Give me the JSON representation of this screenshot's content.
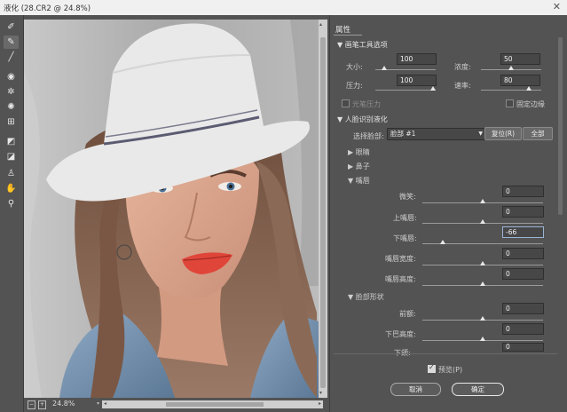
{
  "window": {
    "title": "液化 (28.CR2 @ 24.8%)",
    "close_glyph": "✕"
  },
  "tools": [
    {
      "icon": "forward-warp-icon",
      "glyph": "✐"
    },
    {
      "icon": "reconstruct-icon",
      "glyph": "✎"
    },
    {
      "icon": "smooth-icon",
      "glyph": "╱"
    },
    {
      "icon": "twirl-icon",
      "glyph": "◉"
    },
    {
      "icon": "pucker-icon",
      "glyph": "✲"
    },
    {
      "icon": "bloat-icon",
      "glyph": "✺"
    },
    {
      "icon": "push-left-icon",
      "glyph": "⊞"
    },
    {
      "icon": "freeze-mask-icon",
      "glyph": "◩"
    },
    {
      "icon": "thaw-mask-icon",
      "glyph": "◪"
    },
    {
      "icon": "face-tool-icon",
      "glyph": "♙"
    },
    {
      "icon": "hand-icon",
      "glyph": "✋"
    },
    {
      "icon": "zoom-icon",
      "glyph": "⚲"
    }
  ],
  "status": {
    "zoom": "24.8%",
    "zoom_minus": "−",
    "zoom_plus": "+",
    "zoom_arrow": "▾",
    "scroll_left": "◂",
    "scroll_right": "▸",
    "scroll_up": "▴",
    "scroll_down": "▾"
  },
  "properties": {
    "title": "属性",
    "brush": {
      "header": "▼ 画笔工具选项",
      "size_label": "大小:",
      "size_value": "100",
      "size_level": 0.15,
      "density_label": "浓度:",
      "density_value": "50",
      "density_level": 0.5,
      "pressure_label": "压力:",
      "pressure_value": "100",
      "pressure_level": 0.95,
      "rate_label": "速率:",
      "rate_value": "80",
      "rate_level": 0.8,
      "stylus_label": "光笔压力",
      "pin_edges_label": "固定边缘"
    },
    "face": {
      "header": "▼ 人脸识别液化",
      "select_label": "选择脸部:",
      "select_value": "脸部 #1",
      "reset_label": "复位(R)",
      "all_label": "全部",
      "eyes_header": "▶ 眼睛",
      "nose_header": "▶ 鼻子",
      "mouth_header": "▼ 嘴唇",
      "mouth_sliders": [
        {
          "label": "微笑:",
          "value": "0",
          "level": 0.5
        },
        {
          "label": "上嘴唇:",
          "value": "0",
          "level": 0.5
        },
        {
          "label": "下嘴唇:",
          "value": "-66",
          "level": 0.17
        },
        {
          "label": "嘴唇宽度:",
          "value": "0",
          "level": 0.5
        },
        {
          "label": "嘴唇高度:",
          "value": "0",
          "level": 0.5
        }
      ],
      "face_shape_header": "▼ 脸部形状",
      "shape_sliders": [
        {
          "label": "前额:",
          "value": "0",
          "level": 0.5
        },
        {
          "label": "下巴高度:",
          "value": "0",
          "level": 0.5
        },
        {
          "label": "下颌:",
          "value": "0",
          "level": 0.5
        }
      ]
    },
    "preview_label": "预览(P)",
    "cancel_label": "取消",
    "ok_label": "确定"
  },
  "colors": {
    "panel_bg": "#535353",
    "input_bg": "#474747",
    "titlebar_bg": "#f0f0f0"
  }
}
